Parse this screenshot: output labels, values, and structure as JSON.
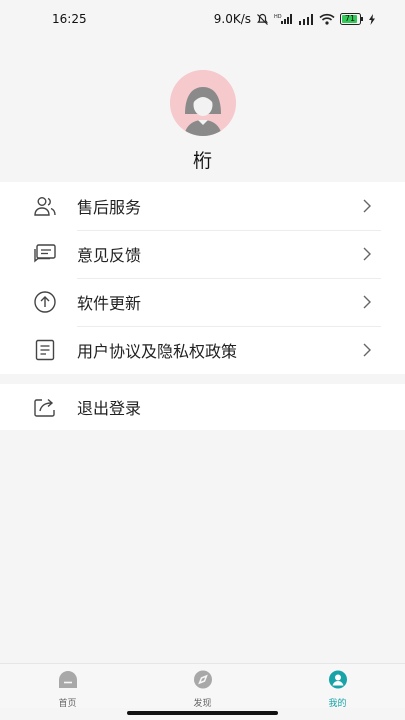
{
  "status_bar": {
    "time": "16:25",
    "network_speed": "9.0K/s",
    "battery_level": "71",
    "icons": [
      "mute-icon",
      "hd-signal-icon",
      "signal-icon",
      "wifi-icon",
      "battery-icon",
      "charging-icon"
    ]
  },
  "profile": {
    "username": "桁"
  },
  "menu": {
    "items": [
      {
        "label": "售后服务",
        "icon": "people-icon"
      },
      {
        "label": "意见反馈",
        "icon": "feedback-icon"
      },
      {
        "label": "软件更新",
        "icon": "upload-icon"
      },
      {
        "label": "用户协议及隐私权政策",
        "icon": "document-icon"
      }
    ]
  },
  "logout": {
    "label": "退出登录",
    "icon": "share-icon"
  },
  "tab_bar": {
    "tabs": [
      {
        "label": "首页",
        "icon": "home-icon",
        "active": false
      },
      {
        "label": "发现",
        "icon": "compass-icon",
        "active": false
      },
      {
        "label": "我的",
        "icon": "profile-icon",
        "active": true
      }
    ]
  },
  "colors": {
    "accent": "#18a3a8",
    "avatar_bg": "#f6c9cc",
    "background": "#f5f5f5"
  }
}
